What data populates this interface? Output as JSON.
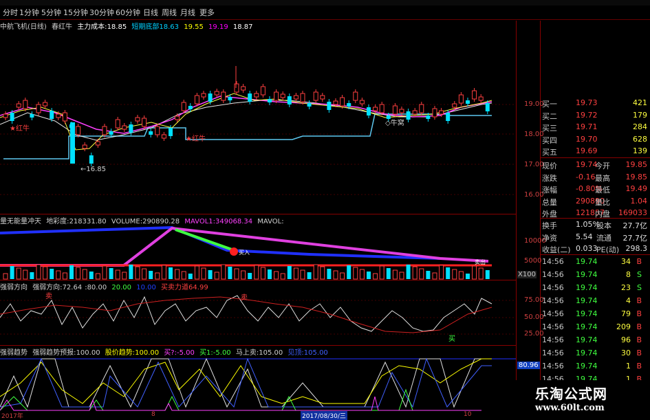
{
  "tabs": [
    "分时",
    "1分钟",
    "5分钟",
    "15分钟",
    "30分钟",
    "60分钟",
    "日线",
    "周线",
    "月线",
    "更多"
  ],
  "info_bar": {
    "name": "中航飞机(日线)",
    "indicator": "春红牛",
    "cost_label": "主力成本:",
    "cost_value": "18.85",
    "cond_label": "短期底部",
    "cond_v1": "18.63",
    "cond_v2": "19.55",
    "v3": "19.19",
    "v4": "18.87"
  },
  "price_axis": [
    "19.00",
    "18.00",
    "17.00",
    "16.00"
  ],
  "main_annotations": {
    "low_label": "←16.85",
    "red_cow1": "★红牛",
    "red_cow2": "★红牛",
    "cow_label": "◇牛窝"
  },
  "volume_head": {
    "name": "量无能量冲天",
    "t1": "地彩度:",
    "v1": "218331.80",
    "t2": "VOLUME:",
    "v2": "290890.28",
    "t3": "MAVOL1:",
    "v3": "349068.34",
    "t4": "MAVOL:"
  },
  "volume_axis": [
    "10000",
    "5000"
  ],
  "volume_unit": "X100",
  "volume_marks": {
    "buy_label": "买入",
    "sell_label": "卖出"
  },
  "strength_head": {
    "name": "强弱方向",
    "t1": "强弱方向:",
    "v1": "72.64",
    "v2": ":80.00",
    "v3": "20.00",
    "v4": "10.00",
    "t5": "买卖力道",
    "v5": "64.99"
  },
  "strength_axis": [
    "75.00",
    "50.00",
    "25.00"
  ],
  "strength_marks": {
    "sell": "卖",
    "buy": "买"
  },
  "trend_head": {
    "name": "强弱趋势",
    "t1": "强弱趋势预报:",
    "v1": "100.00",
    "t2": "股价趋势:",
    "v2": "100.00",
    "t3": "买?:",
    "v3": "-5.00",
    "t4": "买1:",
    "v4": "-5.00",
    "t5": "马上卖:",
    "v5": "105.00",
    "t6": "见顶:",
    "v6": "105.00"
  },
  "trend_value": "80.96",
  "dates": [
    "2017年",
    "8",
    "2017/08/30/三",
    "10"
  ],
  "quote": {
    "buy": [
      {
        "label": "买一",
        "price": "19.73",
        "vol": "421"
      },
      {
        "label": "买二",
        "price": "19.72",
        "vol": "179"
      },
      {
        "label": "买三",
        "price": "19.71",
        "vol": "284"
      },
      {
        "label": "买四",
        "price": "19.70",
        "vol": "628"
      },
      {
        "label": "买五",
        "price": "19.69",
        "vol": "139"
      }
    ],
    "stats": [
      {
        "l1": "现价",
        "v1": "19.74",
        "l2": "今开",
        "v2": "19.85"
      },
      {
        "l1": "涨跌",
        "v1": "-0.16",
        "l2": "最高",
        "v2": "19.85"
      },
      {
        "l1": "涨幅",
        "v1": "-0.80%",
        "l2": "最低",
        "v2": "19.49"
      },
      {
        "l1": "总量",
        "v1": "290890",
        "l2": "量比",
        "v2": "1.04"
      },
      {
        "l1": "外盘",
        "v1": "121857",
        "l2": "内盘",
        "v2": "169033"
      }
    ],
    "stats2": [
      {
        "l1": "换手",
        "v1": "1.05%",
        "l2": "股本",
        "v2": "27.7亿"
      },
      {
        "l1": "净资",
        "v1": "5.54",
        "l2": "流通",
        "v2": "27.7亿"
      },
      {
        "l1": "收益(二)",
        "v1": "0.033",
        "l2": "PE(动)",
        "v2": "298.3"
      }
    ],
    "ticks": [
      {
        "t": "14:56",
        "p": "19.74",
        "v": "34",
        "s": "B"
      },
      {
        "t": "14:56",
        "p": "19.74",
        "v": "8",
        "s": "S"
      },
      {
        "t": "14:56",
        "p": "19.74",
        "v": "23",
        "s": "S"
      },
      {
        "t": "14:56",
        "p": "19.74",
        "v": "4",
        "s": "B"
      },
      {
        "t": "14:56",
        "p": "19.74",
        "v": "79",
        "s": "B"
      },
      {
        "t": "14:56",
        "p": "19.74",
        "v": "209",
        "s": "B"
      },
      {
        "t": "14:56",
        "p": "19.74",
        "v": "96",
        "s": "B"
      },
      {
        "t": "14:56",
        "p": "19.74",
        "v": "30",
        "s": "B"
      },
      {
        "t": "14:56",
        "p": "19.74",
        "v": "1",
        "s": "B"
      },
      {
        "t": "14:56",
        "p": "19.74",
        "v": "1",
        "s": "B"
      },
      {
        "t": "14:56",
        "p": "19.74",
        "v": "1",
        "s": "B"
      }
    ]
  },
  "watermark": {
    "title": "乐淘公式网",
    "url": "www.60lt.com"
  },
  "colors": {
    "up": "#ff4040",
    "down": "#00e0ff",
    "yellow": "#ffff00",
    "grid": "#800000",
    "magenta": "#ff00ff"
  }
}
